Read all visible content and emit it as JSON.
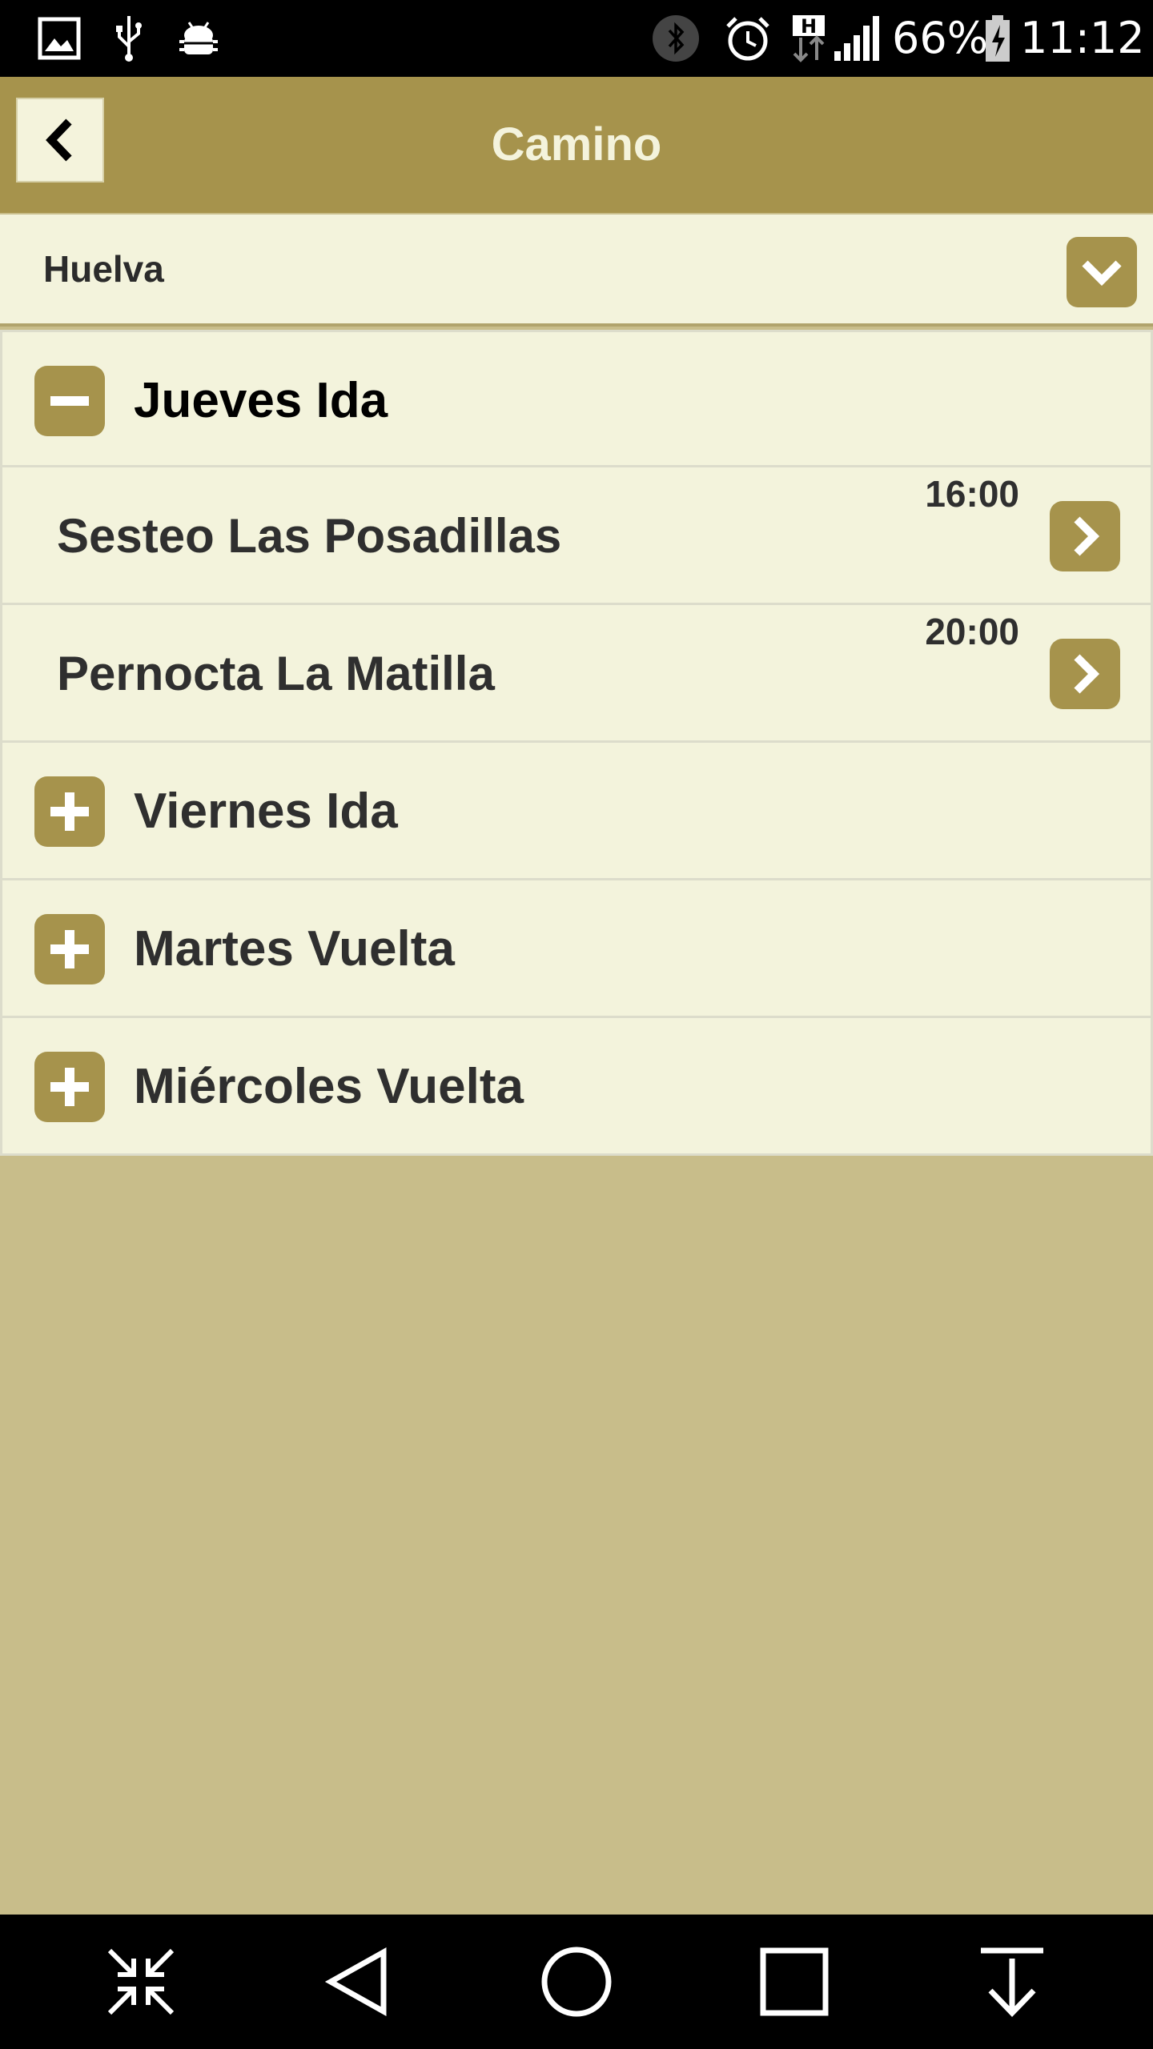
{
  "status_bar": {
    "battery": "66%",
    "time": "11:12",
    "icons": [
      "gallery-icon",
      "usb-icon",
      "android-debug-icon",
      "bluetooth-icon",
      "alarm-icon",
      "h-data-icon",
      "signal-icon",
      "battery-charging-icon"
    ]
  },
  "header": {
    "title": "Camino",
    "back_icon": "chevron-left-icon"
  },
  "selector": {
    "value": "Huelva",
    "icon": "chevron-down-icon"
  },
  "schedule": {
    "groups": [
      {
        "label": "Jueves Ida",
        "expanded": true,
        "items": [
          {
            "label": "Sesteo Las Posadillas",
            "time": "16:00"
          },
          {
            "label": "Pernocta La Matilla",
            "time": "20:00"
          }
        ]
      },
      {
        "label": "Viernes Ida",
        "expanded": false
      },
      {
        "label": "Martes Vuelta",
        "expanded": false
      },
      {
        "label": "Miércoles Vuelta",
        "expanded": false
      }
    ]
  },
  "nav_bar": {
    "icons": [
      "collapse-icon",
      "back-triangle-icon",
      "home-circle-icon",
      "recents-square-icon",
      "download-arrow-icon"
    ]
  },
  "colors": {
    "accent": "#a6934c",
    "panel": "#f3f3dc",
    "background": "#c8bd8a"
  }
}
